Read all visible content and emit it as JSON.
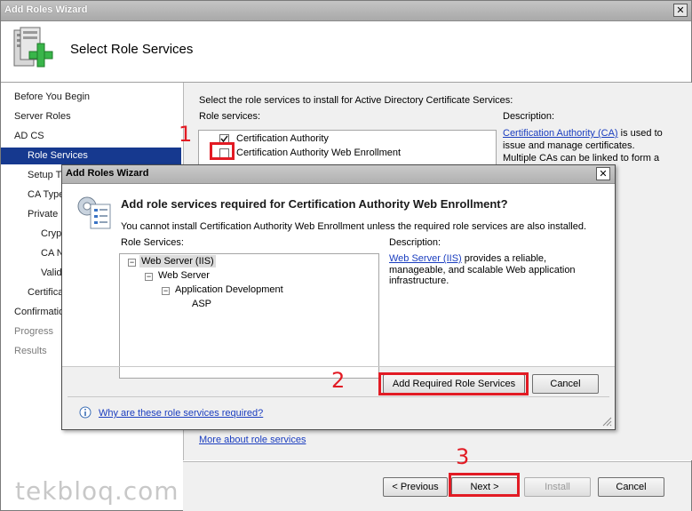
{
  "window": {
    "title": "Add Roles Wizard",
    "page_heading": "Select Role Services"
  },
  "nav": {
    "items": [
      {
        "label": "Before You Begin",
        "indent": 0,
        "state": "normal"
      },
      {
        "label": "Server Roles",
        "indent": 0,
        "state": "normal"
      },
      {
        "label": "AD CS",
        "indent": 0,
        "state": "normal"
      },
      {
        "label": "Role Services",
        "indent": 1,
        "state": "selected"
      },
      {
        "label": "Setup T",
        "indent": 1,
        "state": "normal"
      },
      {
        "label": "CA Type",
        "indent": 1,
        "state": "normal"
      },
      {
        "label": "Private",
        "indent": 1,
        "state": "normal"
      },
      {
        "label": "Cryp",
        "indent": 2,
        "state": "normal"
      },
      {
        "label": "CA N",
        "indent": 2,
        "state": "normal"
      },
      {
        "label": "Valid",
        "indent": 2,
        "state": "normal"
      },
      {
        "label": "Certifica",
        "indent": 1,
        "state": "normal"
      },
      {
        "label": "Confirmatio",
        "indent": 0,
        "state": "normal"
      },
      {
        "label": "Progress",
        "indent": 0,
        "state": "disabled"
      },
      {
        "label": "Results",
        "indent": 0,
        "state": "disabled"
      }
    ]
  },
  "main": {
    "instruction": "Select the role services to install for Active Directory Certificate Services:",
    "role_services_label": "Role services:",
    "services": [
      {
        "label": "Certification Authority",
        "checked": true
      },
      {
        "label": "Certification Authority Web Enrollment",
        "checked": false
      },
      {
        "label": "",
        "checked": false
      }
    ],
    "description_label": "Description:",
    "description_link": "Certification Authority (CA)",
    "description_line1_rest": " is used to",
    "description_line2": "issue and manage certificates.",
    "description_line3": "Multiple CAs can be linked to form a",
    "more_link": "More about role services"
  },
  "footer": {
    "previous": "< Previous",
    "next": "Next >",
    "install": "Install",
    "cancel": "Cancel"
  },
  "dialog": {
    "title": "Add Roles Wizard",
    "heading": "Add role services required for Certification Authority Web Enrollment?",
    "message": "You cannot install Certification Authority Web Enrollment unless the required role services are also installed.",
    "role_services_label": "Role Services:",
    "tree": [
      {
        "label": "Web Server (IIS)",
        "level": 0,
        "expander": true,
        "selected": true
      },
      {
        "label": "Web Server",
        "level": 1,
        "expander": true,
        "selected": false
      },
      {
        "label": "Application Development",
        "level": 2,
        "expander": true,
        "selected": false
      },
      {
        "label": "ASP",
        "level": 3,
        "expander": false,
        "selected": false
      }
    ],
    "description_label": "Description:",
    "description_link": "Web Server (IIS)",
    "description_line1_rest": " provides a reliable,",
    "description_line2": "manageable, and scalable Web application",
    "description_line3": "infrastructure.",
    "add_button": "Add Required Role Services",
    "cancel_button": "Cancel",
    "help_link": "Why are these role services required?"
  },
  "annotations": {
    "step1": "1",
    "step2": "2",
    "step3": "3",
    "color": "#e21b24"
  },
  "watermark": "tekbloq.com",
  "colors": {
    "nav_selected": "#16398f",
    "link": "#1a3dbf",
    "panel": "#f0f0f0"
  }
}
